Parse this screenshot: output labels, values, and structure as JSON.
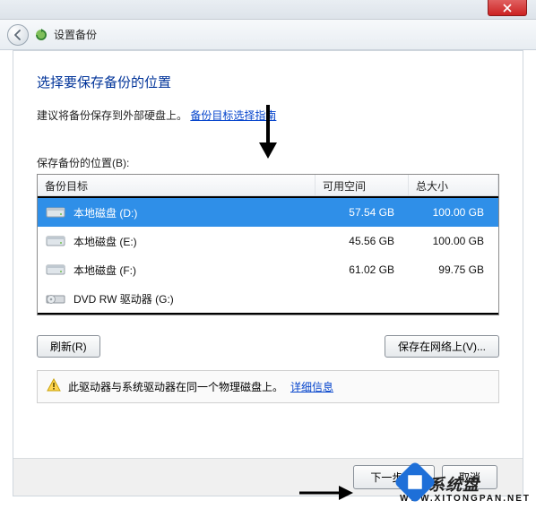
{
  "titlebar": {
    "close_aria": "Close"
  },
  "toolbar": {
    "window_title": "设置备份"
  },
  "page": {
    "title": "选择要保存备份的位置",
    "subtitle_text": "建议将备份保存到外部硬盘上。",
    "subtitle_link": "备份目标选择指南"
  },
  "table": {
    "label": "保存备份的位置(B):",
    "head_target": "备份目标",
    "head_free": "可用空间",
    "head_total": "总大小",
    "rows": [
      {
        "icon": "hdd",
        "name": "本地磁盘 (D:)",
        "free": "57.54 GB",
        "total": "100.00 GB",
        "selected": true
      },
      {
        "icon": "hdd",
        "name": "本地磁盘 (E:)",
        "free": "45.56 GB",
        "total": "100.00 GB",
        "selected": false
      },
      {
        "icon": "hdd",
        "name": "本地磁盘 (F:)",
        "free": "61.02 GB",
        "total": "99.75 GB",
        "selected": false
      },
      {
        "icon": "dvd",
        "name": "DVD RW 驱动器 (G:)",
        "free": "",
        "total": "",
        "selected": false
      }
    ]
  },
  "buttons": {
    "refresh": "刷新(R)",
    "save_network": "保存在网络上(V)...",
    "next": "下一步(N)",
    "cancel": "取消"
  },
  "warning": {
    "text": "此驱动器与系统驱动器在同一个物理磁盘上。",
    "link": "详细信息"
  },
  "watermark": {
    "brand": "系统盘",
    "url": "WWW.XITONGPAN.NET"
  }
}
